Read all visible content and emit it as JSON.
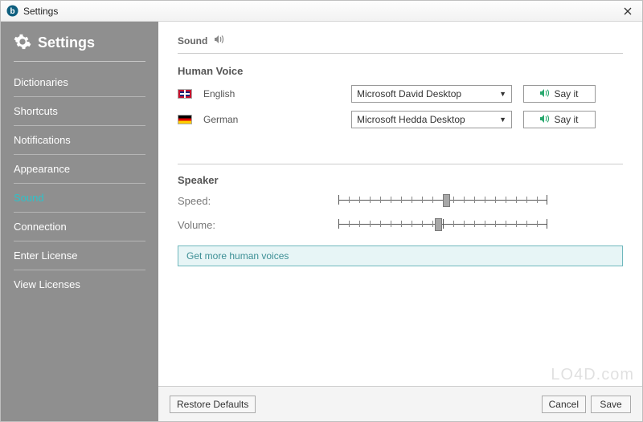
{
  "window": {
    "title": "Settings"
  },
  "sidebar": {
    "heading": "Settings",
    "items": [
      {
        "label": "Dictionaries"
      },
      {
        "label": "Shortcuts"
      },
      {
        "label": "Notifications"
      },
      {
        "label": "Appearance"
      },
      {
        "label": "Sound"
      },
      {
        "label": "Connection"
      },
      {
        "label": "Enter License"
      },
      {
        "label": "View Licenses"
      }
    ],
    "active_index": 4
  },
  "content": {
    "section_title": "Sound",
    "human_voice": {
      "heading": "Human Voice",
      "rows": [
        {
          "lang": "English",
          "flag": "uk",
          "voice": "Microsoft David Desktop",
          "button": "Say it"
        },
        {
          "lang": "German",
          "flag": "de",
          "voice": "Microsoft Hedda Desktop",
          "button": "Say it"
        }
      ]
    },
    "speaker": {
      "heading": "Speaker",
      "speed_label": "Speed:",
      "speed_value": 0.52,
      "volume_label": "Volume:",
      "volume_value": 0.48
    },
    "get_more": "Get more human voices"
  },
  "footer": {
    "restore": "Restore Defaults",
    "cancel": "Cancel",
    "save": "Save"
  },
  "watermark": "LO4D.com"
}
